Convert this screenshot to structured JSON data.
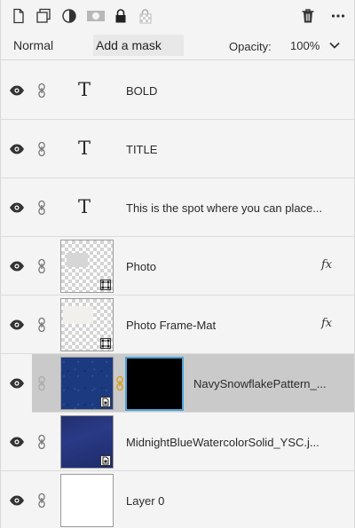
{
  "toolbar": {
    "icons": [
      "new-layer-icon",
      "duplicate-icon",
      "adjustment-icon",
      "mask-icon",
      "lock-icon",
      "lock-transparency-icon",
      "trash-icon",
      "more-icon"
    ]
  },
  "blend": {
    "mode": "Normal",
    "add_mask": "Add a mask",
    "opacity_label": "Opacity:",
    "opacity_value": "100%"
  },
  "layers": [
    {
      "name": "BOLD",
      "type": "text",
      "fx": ""
    },
    {
      "name": "TITLE",
      "type": "text",
      "fx": ""
    },
    {
      "name": "This is the spot where you can place...",
      "type": "text",
      "fx": ""
    },
    {
      "name": "Photo",
      "type": "image",
      "fx": "fx"
    },
    {
      "name": "Photo Frame-Mat",
      "type": "image",
      "fx": "fx"
    },
    {
      "name": "NavySnowflakePattern_...",
      "type": "image-mask",
      "fx": "",
      "selected": true
    },
    {
      "name": "MidnightBlueWatercolorSolid_YSC.j...",
      "type": "image",
      "fx": ""
    },
    {
      "name": "Layer 0",
      "type": "image",
      "fx": ""
    }
  ],
  "colors": {
    "panel_bg": "#f4f4f4",
    "selected_bg": "#cacaca",
    "mask_border": "#4aa3d8",
    "link_gold": "#d6a020"
  }
}
